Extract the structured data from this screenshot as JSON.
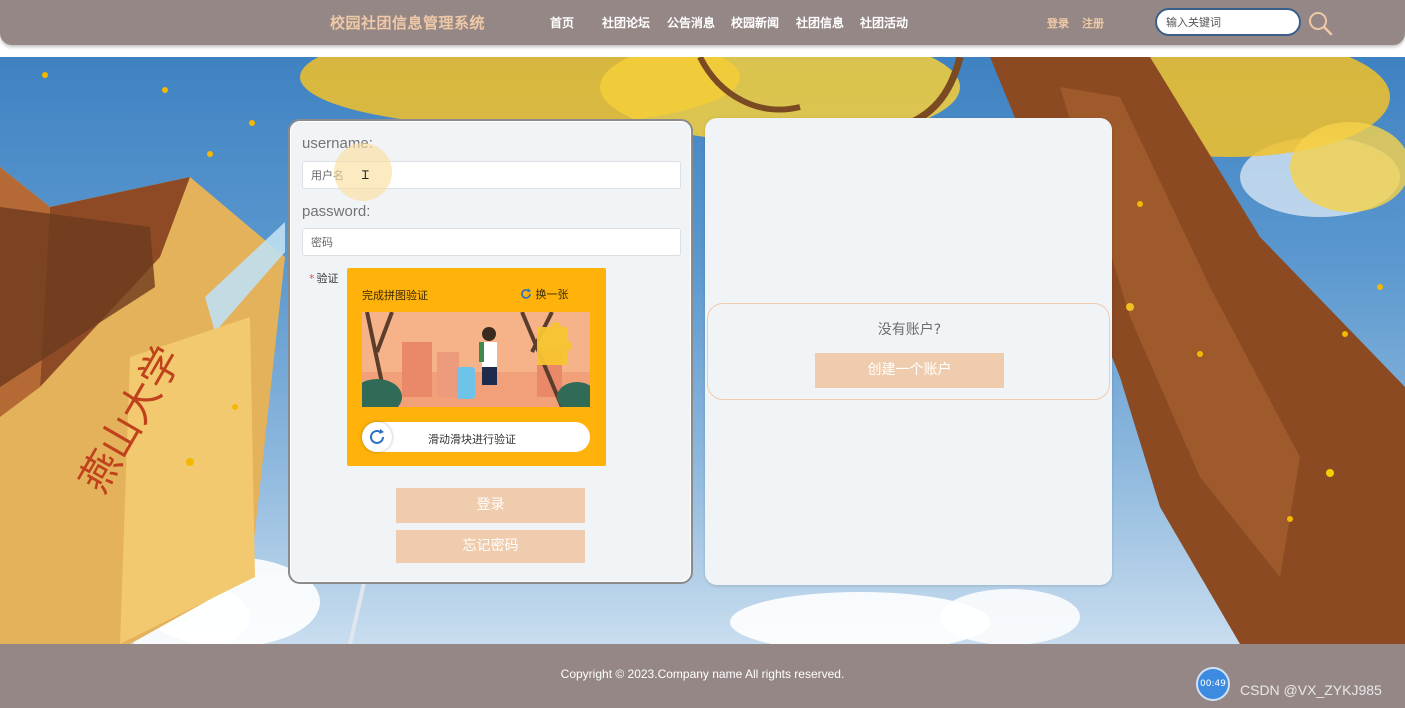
{
  "header": {
    "site_title": "校园社团信息管理系统",
    "nav": [
      "首页",
      "社团论坛",
      "公告消息",
      "校园新闻",
      "社团信息",
      "社团活动"
    ],
    "login_link": "登录",
    "register_link": "注册",
    "search_placeholder": "输入关键词"
  },
  "login": {
    "username_label": "username:",
    "username_placeholder": "用户名",
    "password_label": "password:",
    "password_placeholder": "密码",
    "verify_required_mark": "*",
    "verify_label": "验证",
    "captcha_title": "完成拼图验证",
    "captcha_refresh": "换一张",
    "captcha_slider_hint": "滑动滑块进行验证",
    "login_button": "登录",
    "forgot_button": "忘记密码"
  },
  "register": {
    "question": "没有账户?",
    "create_button": "创建一个账户"
  },
  "footer": {
    "copyright": "Copyright © 2023.Company name All rights reserved.",
    "timer": "00:49",
    "watermark": "CSDN @VX_ZYKJ985"
  },
  "colors": {
    "bar": "#948785",
    "accent_peach": "#efccad",
    "title_peach": "#efc9a7",
    "captcha_yellow": "#ffb20a"
  }
}
